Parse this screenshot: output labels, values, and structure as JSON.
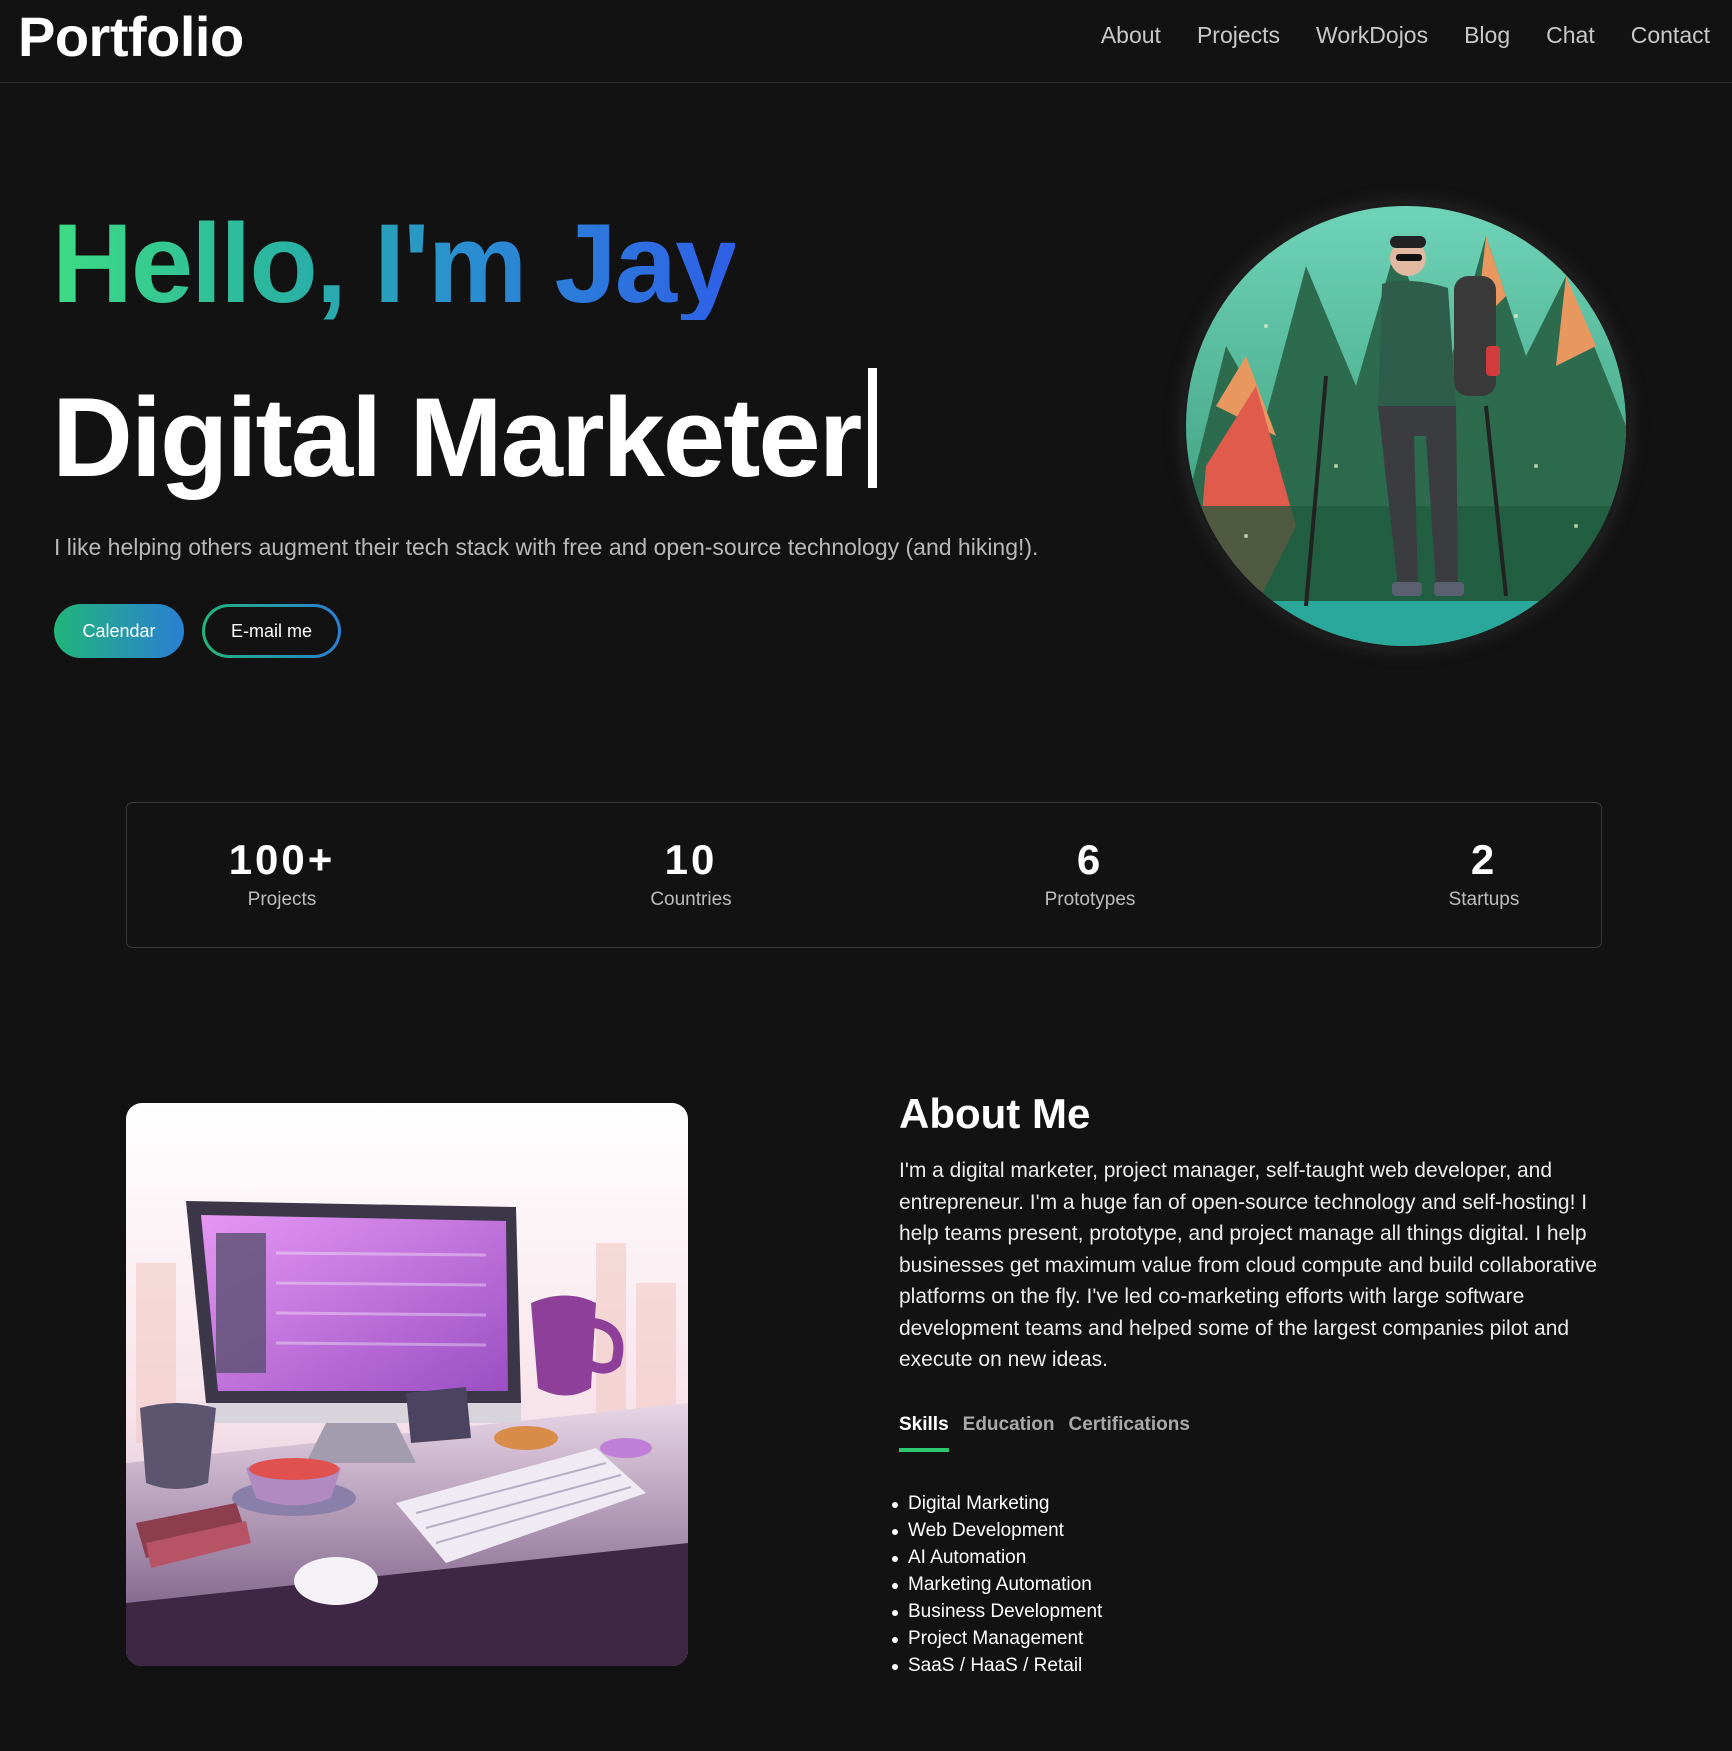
{
  "header": {
    "logo": "Portfolio",
    "nav": [
      {
        "label": "About"
      },
      {
        "label": "Projects"
      },
      {
        "label": "WorkDojos"
      },
      {
        "label": "Blog"
      },
      {
        "label": "Chat"
      },
      {
        "label": "Contact"
      }
    ]
  },
  "hero": {
    "greeting": "Hello, I'm Jay",
    "role": "Digital Marketer",
    "description": "I like helping others augment their tech stack with free and open-source technology (and hiking!).",
    "calendar_label": "Calendar",
    "email_label": "E-mail me"
  },
  "stats": [
    {
      "value": "100+",
      "label": "Projects"
    },
    {
      "value": "10",
      "label": "Countries"
    },
    {
      "value": "6",
      "label": "Prototypes"
    },
    {
      "value": "2",
      "label": "Startups"
    }
  ],
  "about": {
    "title": "About Me",
    "text": "I'm a digital marketer, project manager, self-taught web developer, and entrepreneur. I'm a huge fan of open-source technology and self-hosting! I help teams present, prototype, and project manage all things digital. I help businesses get maximum value from cloud compute and build collaborative platforms on the fly. I've led co-marketing efforts with large software development teams and helped some of the largest companies pilot and execute on new ideas.",
    "tabs": [
      {
        "label": "Skills",
        "active": true
      },
      {
        "label": "Education",
        "active": false
      },
      {
        "label": "Certifications",
        "active": false
      }
    ],
    "skills": [
      "Digital Marketing",
      "Web Development",
      "AI Automation",
      "Marketing Automation",
      "Business Development",
      "Project Management",
      "SaaS / HaaS / Retail"
    ]
  },
  "colors": {
    "background": "#121212",
    "accent_green": "#3ddc84",
    "accent_blue": "#2f5fe8",
    "tab_underline": "#2bc86f"
  }
}
